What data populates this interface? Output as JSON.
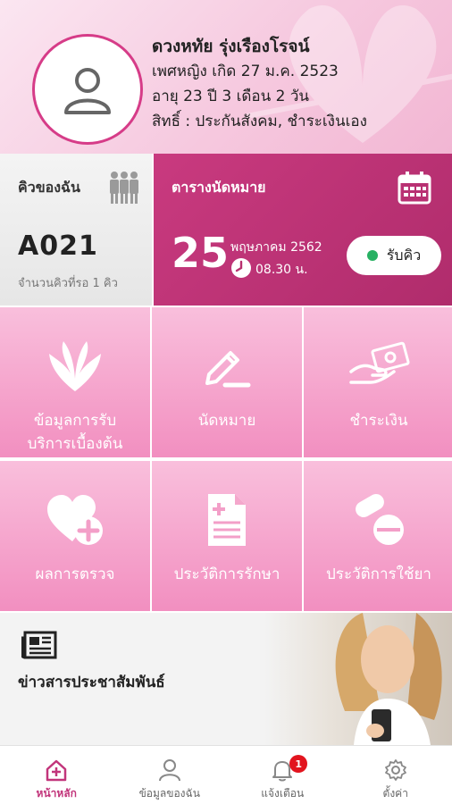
{
  "profile": {
    "name": "ดวงหทัย รุ่งเรืองโรจน์",
    "gender_birth": "เพศหญิง เกิด 27 ม.ค. 2523",
    "age": "อายุ 23 ปี 3 เดือน 2 วัน",
    "rights": "สิทธิ์ : ประกันสังคม, ชำระเงินเอง"
  },
  "queue": {
    "title": "คิวของฉัน",
    "number": "A021",
    "waiting": "จำนวนคิวที่รอ 1 คิว"
  },
  "appointment": {
    "title": "ตารางนัดหมาย",
    "day": "25",
    "month_year": "พฤษภาคม 2562",
    "time": "08.30 น.",
    "get_queue_label": "รับคิว"
  },
  "menu": [
    {
      "label": "ข้อมูลการรับบริการเบื้องต้น",
      "icon": "butterfly-logo-icon"
    },
    {
      "label": "นัดหมาย",
      "icon": "pencil-icon"
    },
    {
      "label": "ชำระเงิน",
      "icon": "hand-money-icon"
    },
    {
      "label": "ผลการตรวจ",
      "icon": "heart-plus-icon"
    },
    {
      "label": "ประวัติการรักษา",
      "icon": "medical-document-icon"
    },
    {
      "label": "ประวัติการใช้ยา",
      "icon": "pills-icon"
    }
  ],
  "menu_line_1": "ข้อมูลการรับ",
  "menu_line_2": "บริการเบื้องต้น",
  "news": {
    "label": "ข่าวสารประชาสัมพันธ์"
  },
  "nav": {
    "home": "หน้าหลัก",
    "my_info": "ข้อมูลของฉัน",
    "notifications": "แจ้งเตือน",
    "notifications_badge": "1",
    "settings": "ตั้งค่า"
  },
  "colors": {
    "accent": "#c2357b",
    "appointment_bg": "#b8306f",
    "tile_top": "#f9bfdc",
    "tile_bottom": "#f28fc0",
    "status_green": "#28b163",
    "badge_red": "#e2141e"
  }
}
